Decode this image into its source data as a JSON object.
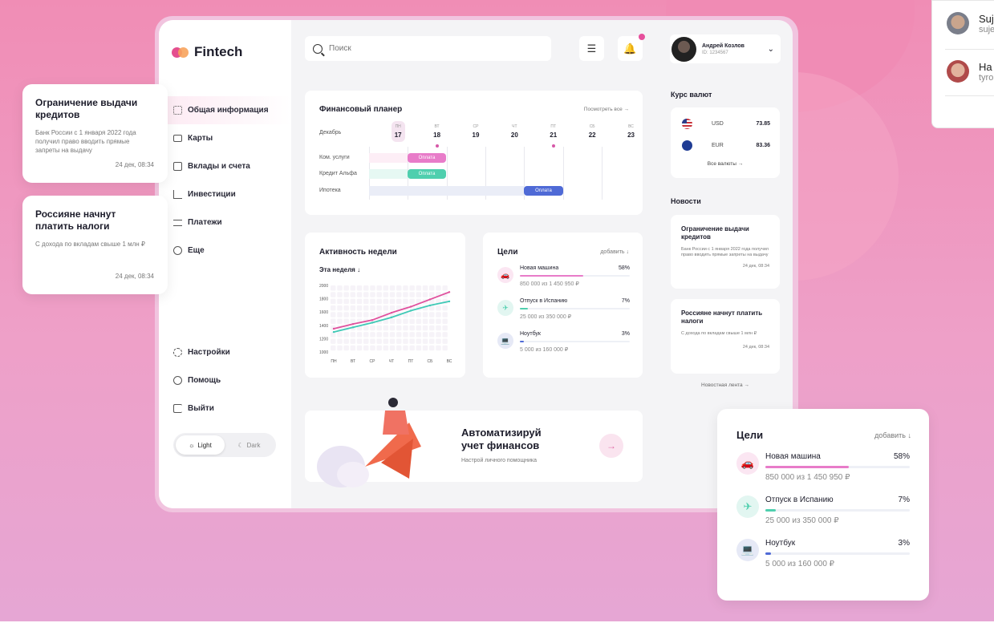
{
  "app": {
    "brand": "Fintech"
  },
  "sidebar": {
    "items": [
      {
        "label": "Общая информация",
        "icon": "grid-icon"
      },
      {
        "label": "Карты",
        "icon": "card-icon"
      },
      {
        "label": "Вклады и счета",
        "icon": "wallet-icon"
      },
      {
        "label": "Инвестиции",
        "icon": "chart-icon"
      },
      {
        "label": "Платежи",
        "icon": "transfer-icon"
      },
      {
        "label": "Еще",
        "icon": "more-icon"
      }
    ],
    "bottom": [
      {
        "label": "Настройки",
        "icon": "gear-icon"
      },
      {
        "label": "Помощь",
        "icon": "help-icon"
      },
      {
        "label": "Выйти",
        "icon": "logout-icon"
      }
    ],
    "theme": {
      "light": "Light",
      "dark": "Dark"
    }
  },
  "header": {
    "search_placeholder": "Поиск",
    "user_name": "Андрей Козлов",
    "user_id": "ID: 1234567"
  },
  "planner": {
    "title": "Финансовый планер",
    "link": "Посмотреть все →",
    "month": "Декабрь",
    "days": [
      {
        "dn": "ПН",
        "d": "17",
        "today": true,
        "event": true
      },
      {
        "dn": "ВТ",
        "d": "18",
        "event": true
      },
      {
        "dn": "СР",
        "d": "19"
      },
      {
        "dn": "ЧТ",
        "d": "20"
      },
      {
        "dn": "ПТ",
        "d": "21",
        "event": true
      },
      {
        "dn": "СБ",
        "d": "22"
      },
      {
        "dn": "ВС",
        "d": "23"
      }
    ],
    "rows": [
      "Ком. услуги",
      "Кредит Альфа",
      "Ипотека"
    ],
    "pay": "Оплата",
    "colors": {
      "pink": "#e87cc9",
      "teal": "#4fcfae",
      "blue": "#4f6ad6"
    }
  },
  "activity": {
    "title": "Активность недели",
    "period": "Эта неделя ↓"
  },
  "chart_data": {
    "type": "line",
    "title": "Активность недели",
    "categories": [
      "ПН",
      "ВТ",
      "СР",
      "ЧТ",
      "ПТ",
      "СБ",
      "ВС"
    ],
    "ylim": [
      1000,
      2000
    ],
    "yticks": [
      "2000",
      "1800",
      "1600",
      "1400",
      "1200",
      "1000"
    ],
    "series": [
      {
        "color": "#e0509d",
        "values": [
          1350,
          1420,
          1480,
          1590,
          1680,
          1790,
          1900
        ]
      },
      {
        "color": "#3fc9b6",
        "values": [
          1300,
          1370,
          1440,
          1520,
          1620,
          1700,
          1760
        ]
      }
    ]
  },
  "goals": {
    "title": "Цели",
    "add": "добавить ↓",
    "items": [
      {
        "name": "Новая машина",
        "pct": "58%",
        "fraction": 0.58,
        "amount": "850 000 из 1 450 950 ₽",
        "color": "#e87cc9",
        "bg": "#fbe6f2",
        "icon": "car-icon",
        "glyph": "🚗"
      },
      {
        "name": "Отпуск в Испанию",
        "pct": "7%",
        "fraction": 0.07,
        "amount": "25 000 из 350 000 ₽",
        "color": "#4fcfae",
        "bg": "#e2f6f1",
        "icon": "plane-icon",
        "glyph": "✈"
      },
      {
        "name": "Ноутбук",
        "pct": "3%",
        "fraction": 0.03,
        "amount": "5 000 из 160 000 ₽",
        "color": "#4f6ad6",
        "bg": "#e6e9f6",
        "icon": "laptop-icon",
        "glyph": "💻"
      }
    ]
  },
  "promo": {
    "title_line1": "Автоматизируй",
    "title_line2": "учет финансов",
    "sub": "Настрой личного помощника",
    "arrow": "→"
  },
  "rates": {
    "title": "Курс валют",
    "items": [
      {
        "code": "USD",
        "value": "73.85",
        "flag": "us-flag-icon"
      },
      {
        "code": "EUR",
        "value": "83.36",
        "flag": "eu-flag-icon"
      }
    ],
    "all": "Все валюты →"
  },
  "news": {
    "title": "Новости",
    "items": [
      {
        "title": "Ограничение выдачи кредитов",
        "body": "Банк России с 1 января 2022 года получил право вводить прямые запреты на выдачу",
        "date": "24 дек, 08:34"
      },
      {
        "title": "Россияне начнут платить налоги",
        "body": "С дохода по вкладам свыше 1 млн ₽",
        "date": "24 дек, 08:34"
      }
    ],
    "feed": "Новостная лента →"
  },
  "side_list": {
    "items": [
      {
        "name": "Suj",
        "sub": "suje"
      },
      {
        "name": "Ha",
        "sub": "tyro"
      }
    ]
  }
}
